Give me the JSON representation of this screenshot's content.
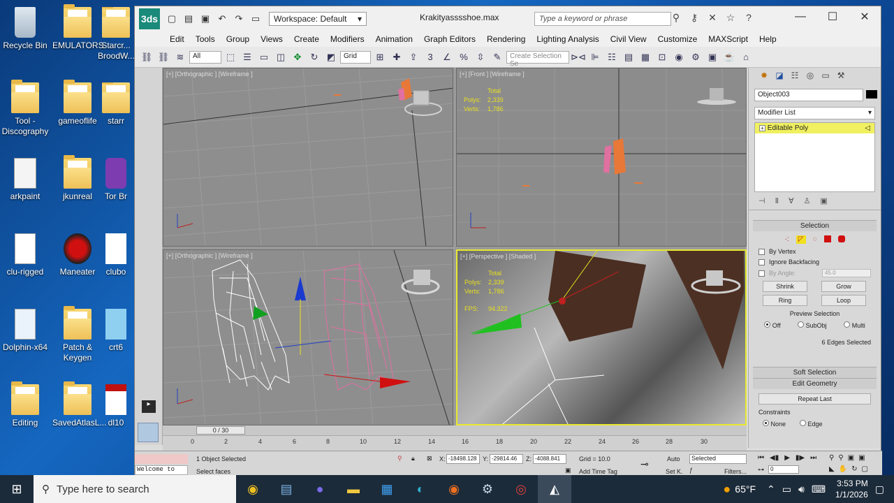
{
  "desktop": {
    "icons": [
      {
        "label": "Recycle Bin"
      },
      {
        "label": "EMULATORS"
      },
      {
        "label": "Starcr... BroodW..."
      },
      {
        "label": "Tool - Discography"
      },
      {
        "label": "gameoflife"
      },
      {
        "label": "starr"
      },
      {
        "label": "arkpaint"
      },
      {
        "label": "jkunreal"
      },
      {
        "label": "Tor Br"
      },
      {
        "label": "clu-rigged"
      },
      {
        "label": "Maneater"
      },
      {
        "label": "clubo"
      },
      {
        "label": "Dolphin-x64"
      },
      {
        "label": "Patch & Keygen"
      },
      {
        "label": "crt6"
      },
      {
        "label": "Editing"
      },
      {
        "label": "SavedAtlasL..."
      },
      {
        "label": "dl10"
      }
    ]
  },
  "window": {
    "app_logo": "3ds",
    "workspace": "Workspace: Default",
    "title": "Krakityasssshoe.max",
    "search_placeholder": "Type a keyword or phrase",
    "menu": [
      "Edit",
      "Tools",
      "Group",
      "Views",
      "Create",
      "Modifiers",
      "Animation",
      "Graph Editors",
      "Rendering",
      "Lighting Analysis",
      "Civil View",
      "Customize",
      "MAXScript",
      "Help"
    ],
    "toolbar": {
      "filter": "All",
      "ref_coord": "Grid",
      "selection_set_placeholder": "Create Selection Se"
    }
  },
  "viewports": [
    {
      "label": "[+] [Orthographic ] [Wireframe ]"
    },
    {
      "label": "[+] [Front ] [Wireframe ]",
      "stats": {
        "total": "Total",
        "polys_k": "Polys:",
        "polys_v": "2,339",
        "verts_k": "Verts:",
        "verts_v": "1,786"
      }
    },
    {
      "label": "[+] [Orthographic ] [Wireframe ]"
    },
    {
      "label": "[+] [Perspective ] [Shaded ]",
      "stats": {
        "total": "Total",
        "polys_k": "Polys:",
        "polys_v": "2,339",
        "verts_k": "Verts:",
        "verts_v": "1,786",
        "fps_k": "FPS:",
        "fps_v": "94.322"
      }
    }
  ],
  "command_panel": {
    "object_name": "Object003",
    "modifier_list": "Modifier List",
    "stack_item": "Editable Poly",
    "selection": {
      "title": "Selection",
      "by_vertex": "By Vertex",
      "ignore_backfacing": "Ignore Backfacing",
      "by_angle": "By Angle:",
      "angle_value": "45.0",
      "shrink": "Shrink",
      "grow": "Grow",
      "ring": "Ring",
      "loop": "Loop",
      "preview_selection": "Preview Selection",
      "off": "Off",
      "subobj": "SubObj",
      "multi": "Multi",
      "status": "6 Edges Selected"
    },
    "soft_selection": "Soft Selection",
    "edit_geometry": "Edit Geometry",
    "repeat_last": "Repeat Last",
    "constraints": "Constraints",
    "none": "None",
    "edge": "Edge"
  },
  "timeline": {
    "frame": "0 / 30",
    "ticks": [
      "0",
      "2",
      "4",
      "6",
      "8",
      "10",
      "12",
      "14",
      "16",
      "18",
      "20",
      "22",
      "24",
      "26",
      "28",
      "30"
    ]
  },
  "status": {
    "maxscript": "Welcome to",
    "objects_selected": "1 Object Selected",
    "prompt": "Select faces",
    "x_label": "X:",
    "x_value": "-18498.128",
    "y_label": "Y:",
    "y_value": "-29814.46",
    "z_label": "Z:",
    "z_value": "-4088.841",
    "grid": "Grid = 10.0",
    "add_time_tag": "Add Time Tag",
    "auto": "Auto",
    "set_k": "Set K.",
    "selected": "Selected",
    "filters": "Filters...",
    "frame_field": "0"
  },
  "taskbar": {
    "search_placeholder": "Type here to search",
    "weather": "65°F",
    "time": "3:53 PM",
    "date": "1/1/2026"
  }
}
